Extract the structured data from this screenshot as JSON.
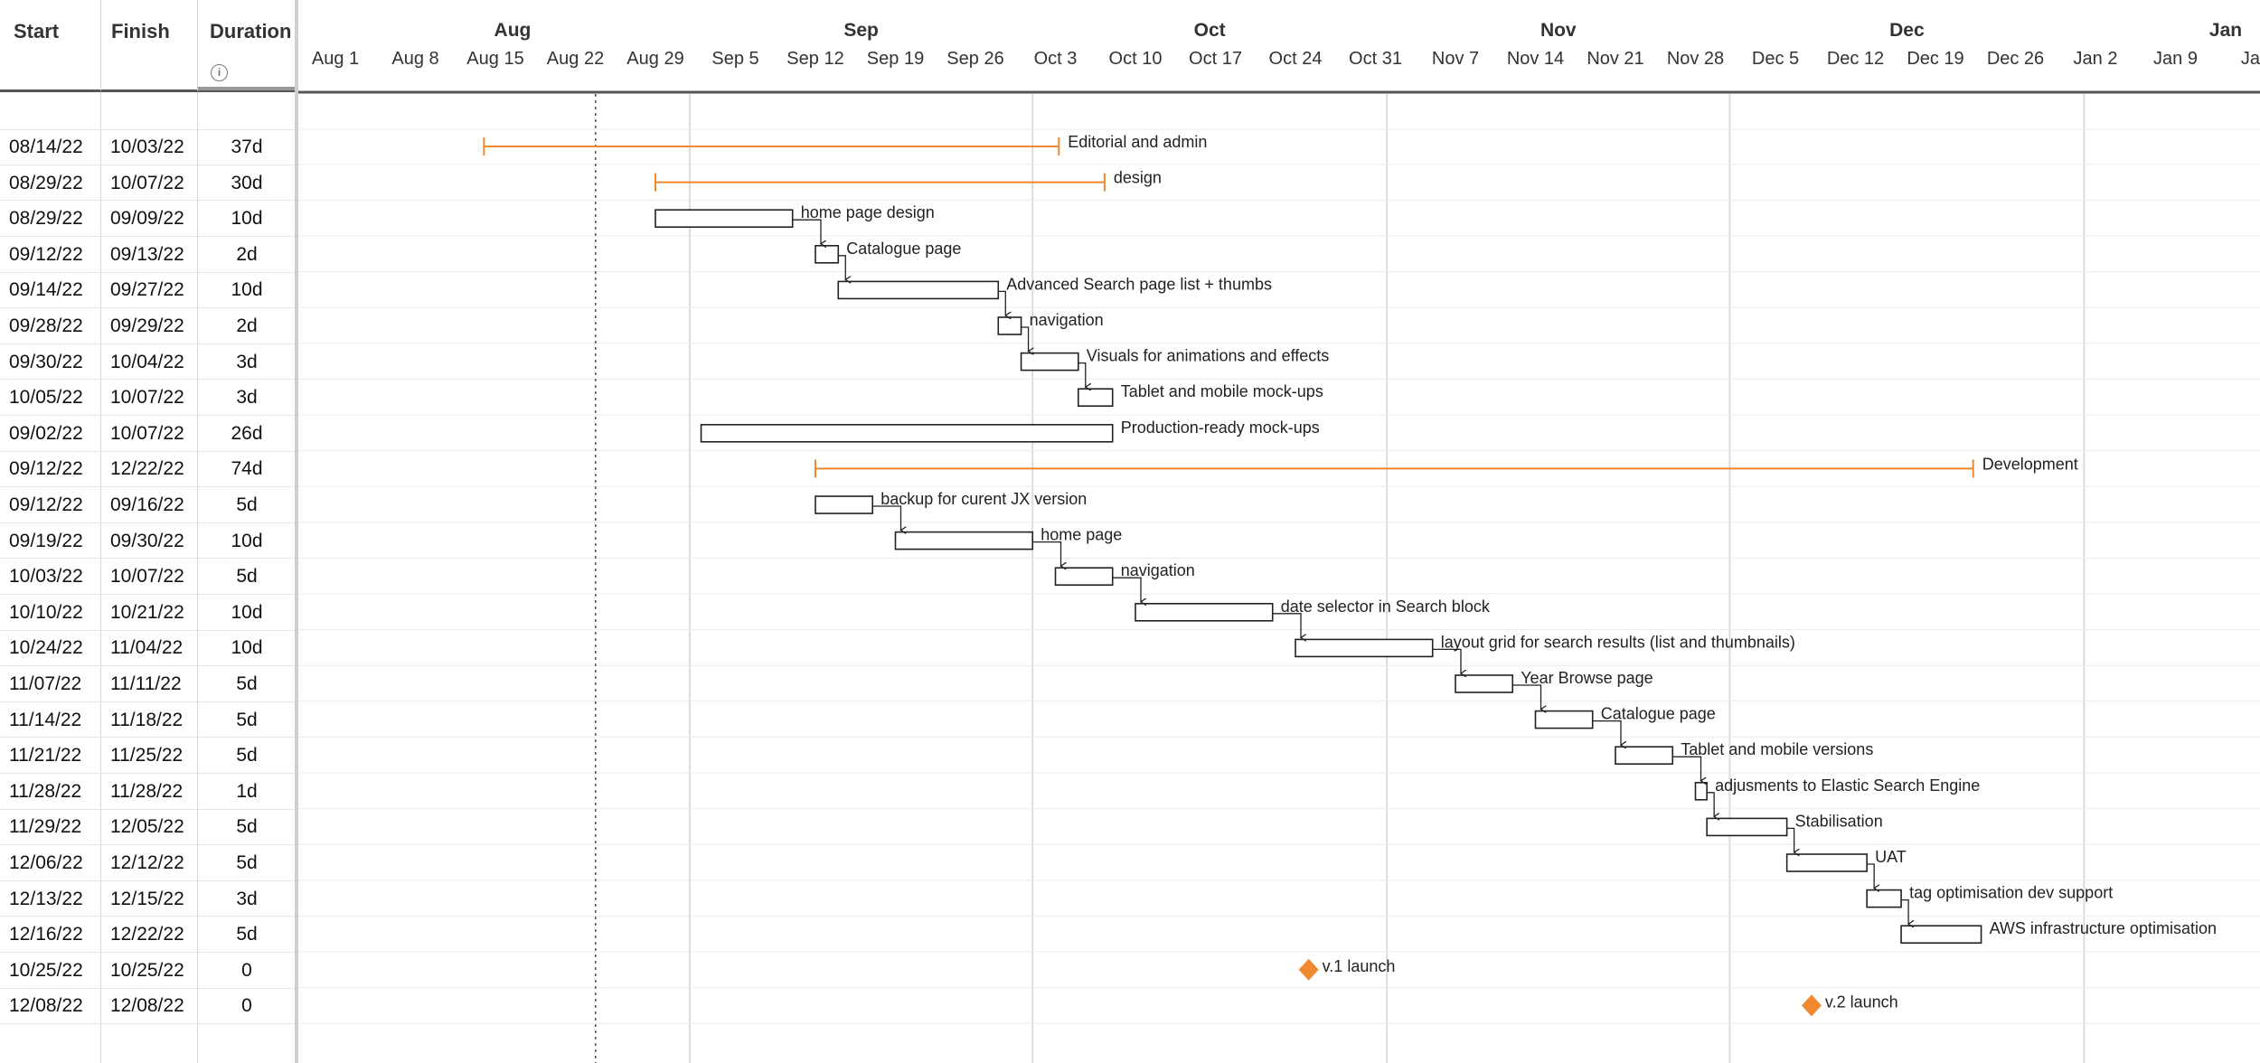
{
  "columns": {
    "start": "Start",
    "finish": "Finish",
    "duration": "Duration",
    "info_icon": "info-icon"
  },
  "timeline": {
    "months": [
      "Aug",
      "Sep",
      "Oct",
      "Nov",
      "Dec",
      "Jan"
    ],
    "weeks": [
      "Aug 1",
      "Aug 8",
      "Aug 15",
      "Aug 22",
      "Aug 29",
      "Sep 5",
      "Sep 12",
      "Sep 19",
      "Sep 26",
      "Oct 3",
      "Oct 10",
      "Oct 17",
      "Oct 24",
      "Oct 31",
      "Nov 7",
      "Nov 14",
      "Nov 21",
      "Nov 28",
      "Dec 5",
      "Dec 12",
      "Dec 19",
      "Dec 26",
      "Jan 2",
      "Jan 9",
      "Jan"
    ],
    "today_marker": "08/24/22"
  },
  "colors": {
    "summary": "#f0892f",
    "milestone": "#f0892f",
    "bar_border": "#222222",
    "grid": "#e6e6e6"
  },
  "tasks": [
    {
      "start": "08/14/22",
      "finish": "10/03/22",
      "duration": "37d",
      "name": "Editorial and admin",
      "type": "summary"
    },
    {
      "start": "08/29/22",
      "finish": "10/07/22",
      "duration": "30d",
      "name": "design",
      "type": "summary"
    },
    {
      "start": "08/29/22",
      "finish": "09/09/22",
      "duration": "10d",
      "name": "home page design",
      "type": "task"
    },
    {
      "start": "09/12/22",
      "finish": "09/13/22",
      "duration": "2d",
      "name": "Catalogue page",
      "type": "task"
    },
    {
      "start": "09/14/22",
      "finish": "09/27/22",
      "duration": "10d",
      "name": "Advanced Search page list + thumbs",
      "type": "task"
    },
    {
      "start": "09/28/22",
      "finish": "09/29/22",
      "duration": "2d",
      "name": "navigation",
      "type": "task"
    },
    {
      "start": "09/30/22",
      "finish": "10/04/22",
      "duration": "3d",
      "name": "Visuals for animations and effects",
      "type": "task"
    },
    {
      "start": "10/05/22",
      "finish": "10/07/22",
      "duration": "3d",
      "name": "Tablet and mobile mock-ups",
      "type": "task"
    },
    {
      "start": "09/02/22",
      "finish": "10/07/22",
      "duration": "26d",
      "name": "Production-ready mock-ups",
      "type": "task"
    },
    {
      "start": "09/12/22",
      "finish": "12/22/22",
      "duration": "74d",
      "name": "Development",
      "type": "summary"
    },
    {
      "start": "09/12/22",
      "finish": "09/16/22",
      "duration": "5d",
      "name": "backup for curent JX version",
      "type": "task"
    },
    {
      "start": "09/19/22",
      "finish": "09/30/22",
      "duration": "10d",
      "name": "home page",
      "type": "task"
    },
    {
      "start": "10/03/22",
      "finish": "10/07/22",
      "duration": "5d",
      "name": "navigation",
      "type": "task"
    },
    {
      "start": "10/10/22",
      "finish": "10/21/22",
      "duration": "10d",
      "name": "date selector in Search block",
      "type": "task"
    },
    {
      "start": "10/24/22",
      "finish": "11/04/22",
      "duration": "10d",
      "name": "layout grid for search results (list and thumbnails)",
      "type": "task"
    },
    {
      "start": "11/07/22",
      "finish": "11/11/22",
      "duration": "5d",
      "name": "Year Browse page",
      "type": "task"
    },
    {
      "start": "11/14/22",
      "finish": "11/18/22",
      "duration": "5d",
      "name": "Catalogue page",
      "type": "task"
    },
    {
      "start": "11/21/22",
      "finish": "11/25/22",
      "duration": "5d",
      "name": "Tablet and mobile versions",
      "type": "task"
    },
    {
      "start": "11/28/22",
      "finish": "11/28/22",
      "duration": "1d",
      "name": "adjusments to Elastic Search Engine",
      "type": "task"
    },
    {
      "start": "11/29/22",
      "finish": "12/05/22",
      "duration": "5d",
      "name": "Stabilisation",
      "type": "task"
    },
    {
      "start": "12/06/22",
      "finish": "12/12/22",
      "duration": "5d",
      "name": "UAT",
      "type": "task"
    },
    {
      "start": "12/13/22",
      "finish": "12/15/22",
      "duration": "3d",
      "name": "tag optimisation dev support",
      "type": "task"
    },
    {
      "start": "12/16/22",
      "finish": "12/22/22",
      "duration": "5d",
      "name": "AWS infrastructure optimisation",
      "type": "task"
    },
    {
      "start": "10/25/22",
      "finish": "10/25/22",
      "duration": "0",
      "name": "v.1 launch",
      "type": "milestone"
    },
    {
      "start": "12/08/22",
      "finish": "12/08/22",
      "duration": "0",
      "name": "v.2 launch",
      "type": "milestone"
    }
  ],
  "dependencies": [
    [
      2,
      3
    ],
    [
      3,
      4
    ],
    [
      4,
      5
    ],
    [
      5,
      6
    ],
    [
      6,
      7
    ],
    [
      10,
      11
    ],
    [
      11,
      12
    ],
    [
      12,
      13
    ],
    [
      13,
      14
    ],
    [
      14,
      15
    ],
    [
      15,
      16
    ],
    [
      16,
      17
    ],
    [
      17,
      18
    ],
    [
      18,
      19
    ],
    [
      19,
      20
    ],
    [
      20,
      21
    ],
    [
      21,
      22
    ]
  ]
}
